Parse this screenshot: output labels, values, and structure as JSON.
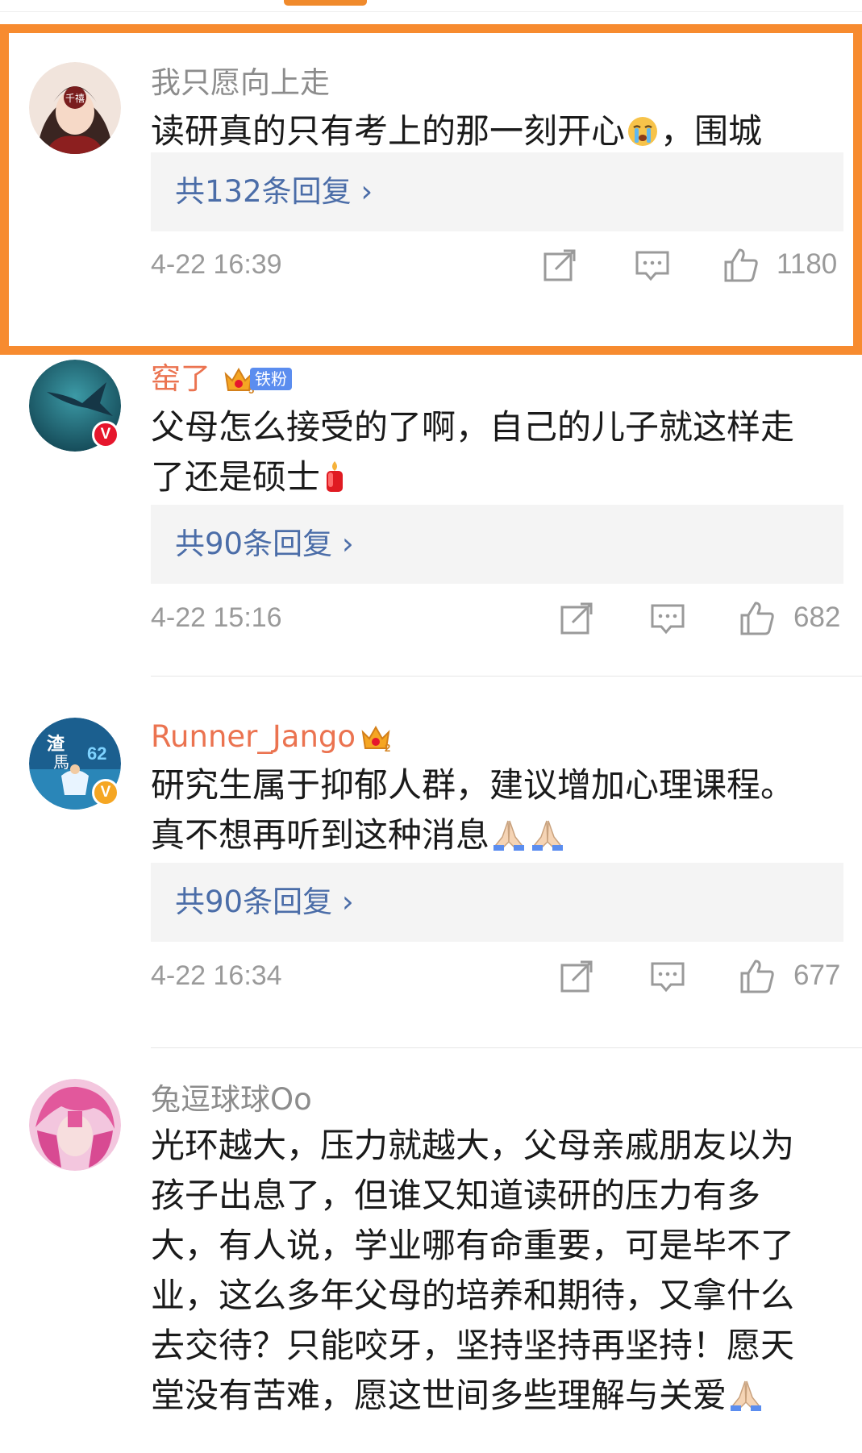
{
  "colors": {
    "highlight_border": "#f78b2f",
    "vip_name": "#eb7350",
    "reply_link": "#4b6da8",
    "verified_red": "#e6162d",
    "verified_gold": "#f5a623"
  },
  "comments": [
    {
      "username": "我只愿向上走",
      "content": "读研真的只有考上的那一刻开心",
      "content_tail": "，围城",
      "emoji": "crying-face",
      "replies_label": "共132条回复 ›",
      "timestamp": "4-22 16:39",
      "likes": "1180",
      "highlighted": true
    },
    {
      "username": "窑了",
      "fan_badge": "铁粉",
      "crown_level": "5",
      "verified": "V",
      "content_line1": "父母怎么接受的了啊，自己的儿子就这样走",
      "content_line2": "了还是硕士",
      "emoji": "candle",
      "replies_label": "共90条回复 ›",
      "timestamp": "4-22 15:16",
      "likes": "682"
    },
    {
      "username": "Runner_Jango",
      "crown_level": "2",
      "verified": "V",
      "content_line1": "研究生属于抑郁人群，建议增加心理课程。",
      "content_line2": "真不想再听到这种消息",
      "emoji": "praying-hands",
      "replies_label": "共90条回复 ›",
      "timestamp": "4-22 16:34",
      "likes": "677"
    },
    {
      "username": "兔逗球球Oo",
      "content_lines": [
        "光环越大，压力就越大，父母亲戚朋友以为",
        "孩子出息了，但谁又知道读研的压力有多",
        "大，有人说，学业哪有命重要，可是毕不了",
        "业，这么多年父母的培养和期待，又拿什么",
        "去交待？只能咬牙，坚持坚持再坚持！愿天",
        "堂没有苦难，愿这世间多些理解与关爱"
      ],
      "emoji": "praying-hands"
    }
  ]
}
